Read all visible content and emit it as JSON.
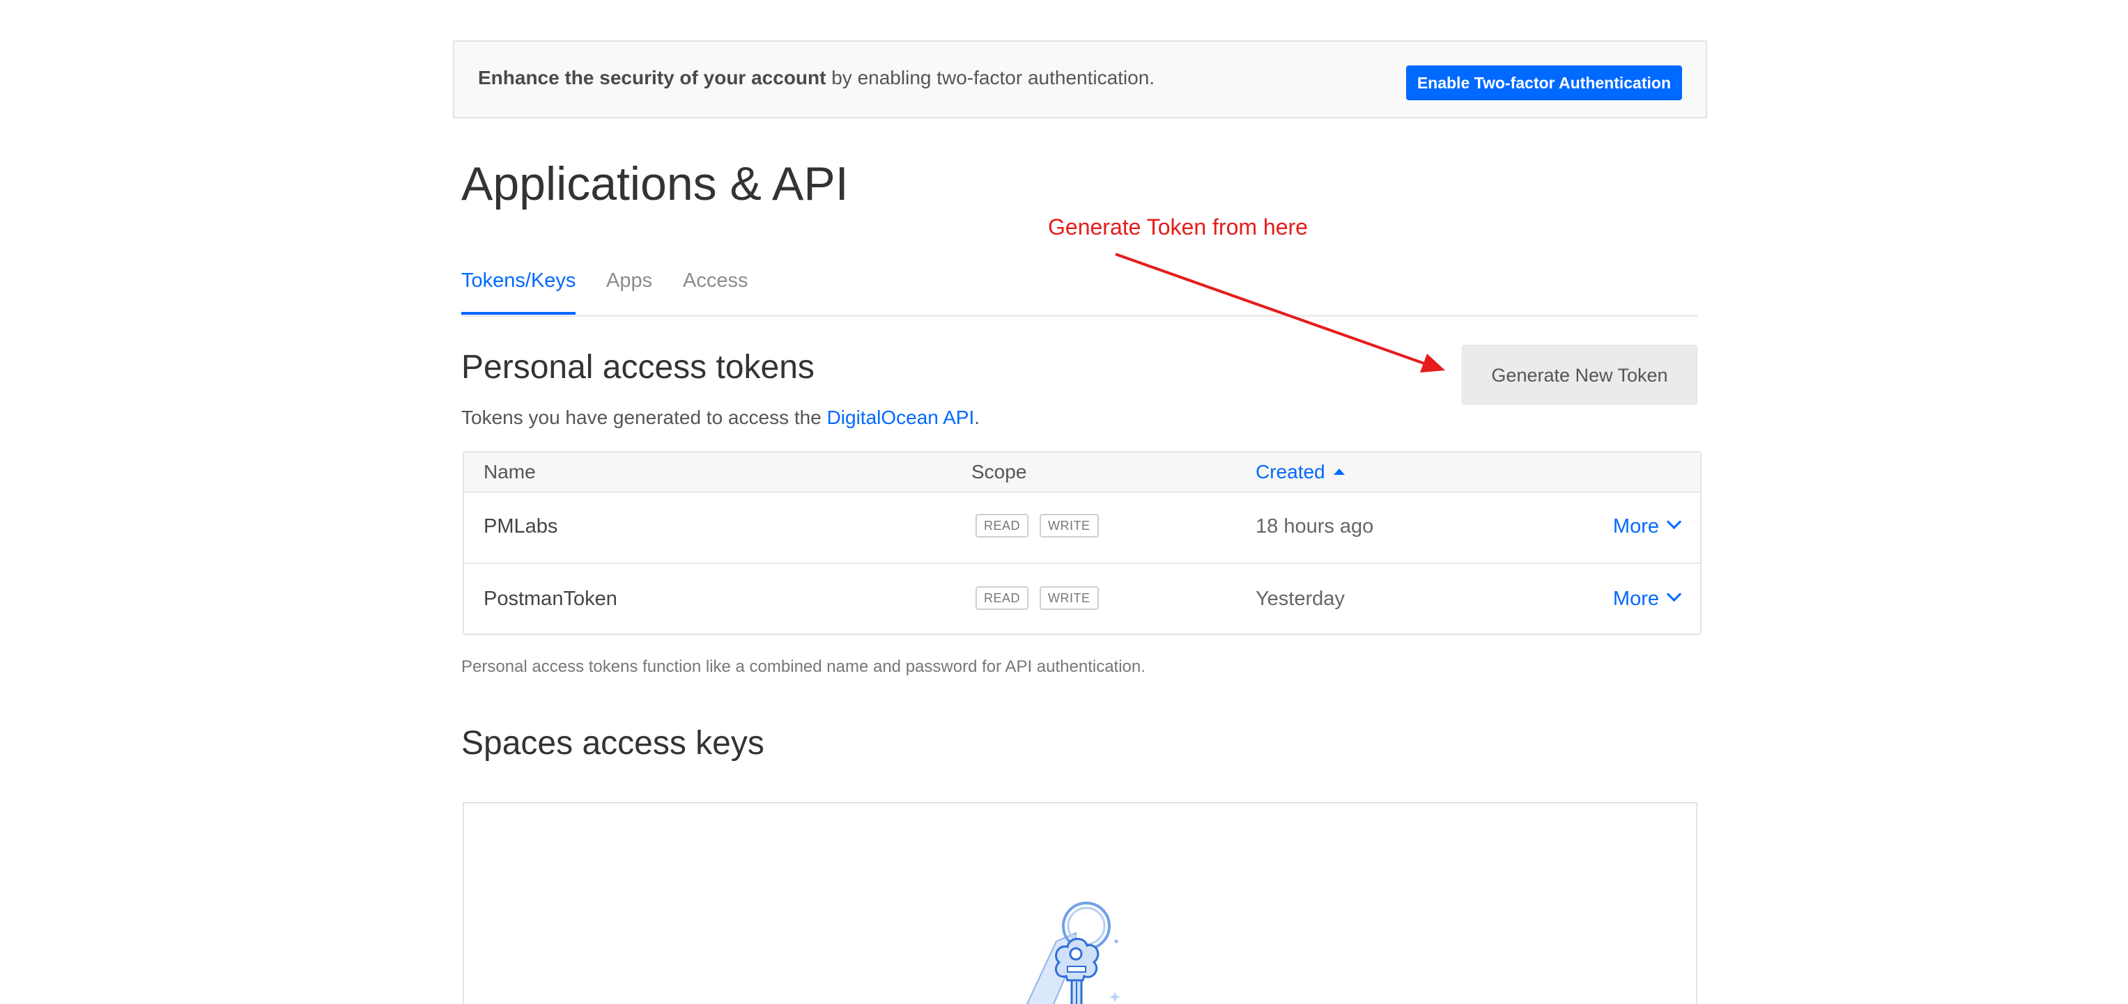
{
  "banner": {
    "bold_text": "Enhance the security of your account",
    "text": " by enabling two-factor authentication.",
    "button_label": "Enable Two-factor Authentication"
  },
  "page": {
    "title": "Applications & API"
  },
  "tabs": [
    {
      "label": "Tokens/Keys",
      "active": true
    },
    {
      "label": "Apps",
      "active": false
    },
    {
      "label": "Access",
      "active": false
    }
  ],
  "annotation": {
    "text": "Generate Token from here",
    "color": "#e61c1c"
  },
  "personal_tokens": {
    "title": "Personal access tokens",
    "description_prefix": "Tokens you have generated to access the ",
    "description_link": "DigitalOcean API",
    "description_suffix": ".",
    "generate_button": "Generate New Token",
    "table": {
      "columns": [
        "Name",
        "Scope",
        "Created"
      ],
      "sorted_column": "Created",
      "rows": [
        {
          "name": "PMLabs",
          "scopes": [
            "READ",
            "WRITE"
          ],
          "created": "18 hours ago",
          "action": "More"
        },
        {
          "name": "PostmanToken",
          "scopes": [
            "READ",
            "WRITE"
          ],
          "created": "Yesterday",
          "action": "More"
        }
      ]
    },
    "footnote": "Personal access tokens function like a combined name and password for API authentication."
  },
  "spaces_keys": {
    "title": "Spaces access keys",
    "illustration_icon": "key-icon"
  },
  "colors": {
    "accent": "#0069ff",
    "banner_bg": "#f9f9f9",
    "button_gray": "#ebebeb"
  }
}
